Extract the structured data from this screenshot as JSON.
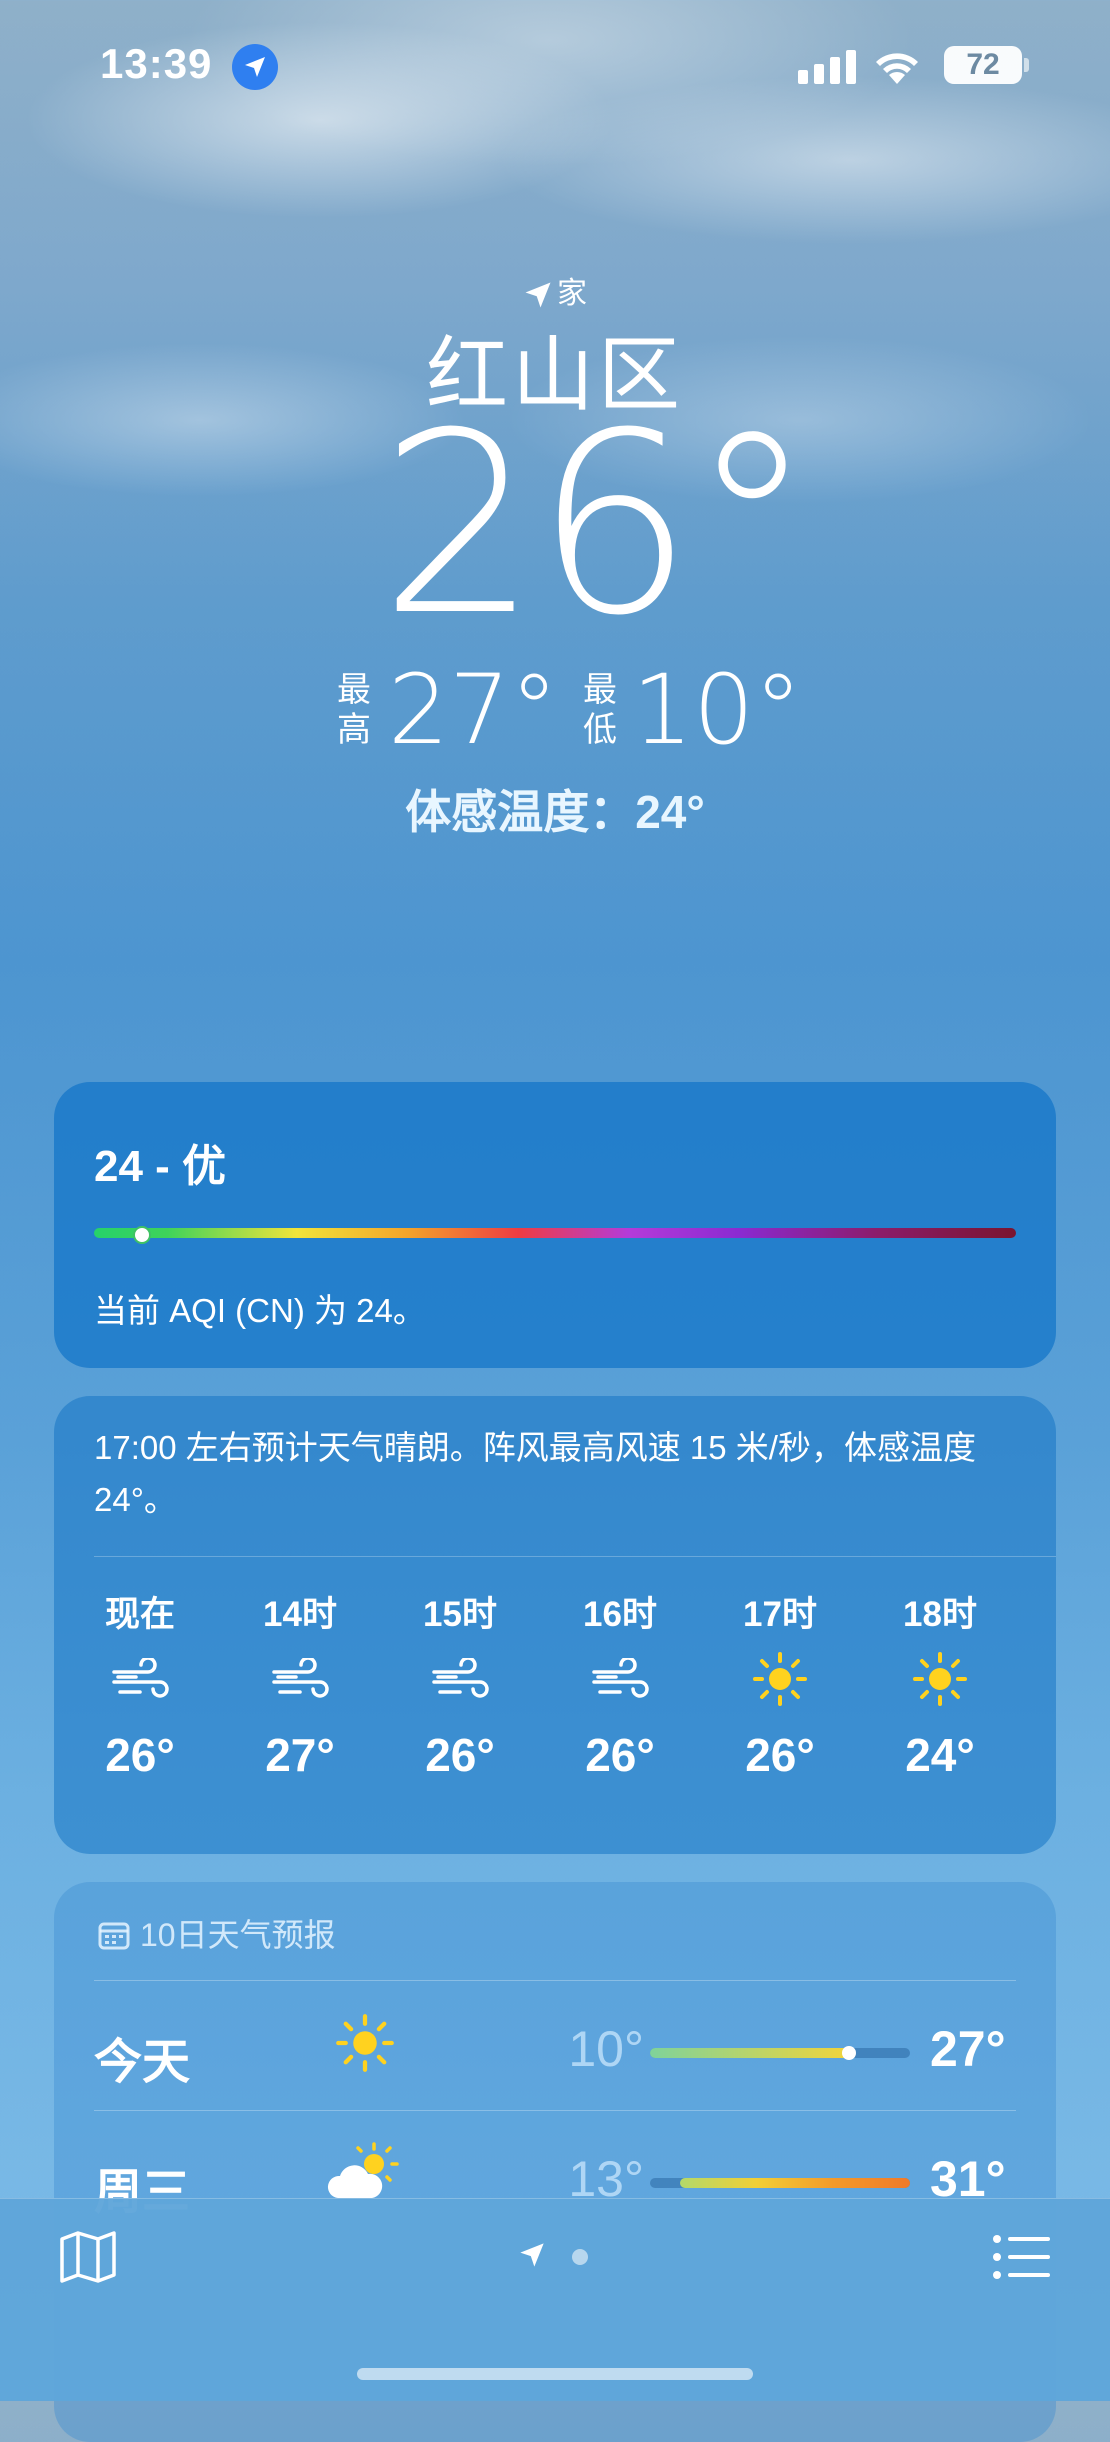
{
  "status_bar": {
    "time": "13:39",
    "battery": "72"
  },
  "hero": {
    "location_label": "家",
    "city": "红山区",
    "current_temp": "26°",
    "high_label": "最高",
    "high": "27°",
    "low_label": "最低",
    "low": "10°",
    "feels_like": "体感温度：24°"
  },
  "aqi": {
    "title": "24 - 优",
    "level": 0.05,
    "description": "当前 AQI (CN) 为 24。"
  },
  "hourly": {
    "summary": "17:00 左右预计天气晴朗。阵风最高风速 15 米/秒，体感温度 24°。",
    "hours": [
      {
        "label": "现在",
        "icon": "wind-icon",
        "temp": "26°"
      },
      {
        "label": "14时",
        "icon": "wind-icon",
        "temp": "27°"
      },
      {
        "label": "15时",
        "icon": "wind-icon",
        "temp": "26°"
      },
      {
        "label": "16时",
        "icon": "wind-icon",
        "temp": "26°"
      },
      {
        "label": "17时",
        "icon": "sun-icon",
        "temp": "26°"
      },
      {
        "label": "18时",
        "icon": "sun-icon",
        "temp": "24°"
      }
    ]
  },
  "ten_day": {
    "title": "10日天气预报",
    "days": [
      {
        "name": "今天",
        "icon": "sun-icon",
        "low": "10°",
        "high": "27°"
      },
      {
        "name": "周三",
        "icon": "partly-cloudy-icon",
        "low": "13°",
        "high": "31°"
      }
    ]
  },
  "colors": {
    "accent_blue": "#2f7ff0",
    "sun_yellow": "#ffd21f"
  }
}
